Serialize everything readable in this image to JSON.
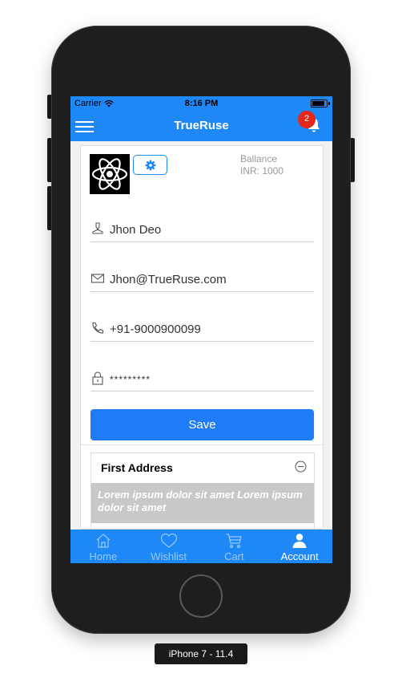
{
  "status_bar": {
    "carrier": "Carrier",
    "time": "8:16 PM"
  },
  "nav_bar": {
    "title": "TrueRuse",
    "notification_count": "2"
  },
  "profile": {
    "balance_label": "Ballance",
    "balance_value": "INR: 1000"
  },
  "fields": {
    "name": "Jhon Deo",
    "email": "Jhon@TrueRuse.com",
    "phone": "+91-9000900099",
    "password": "*********"
  },
  "save_label": "Save",
  "address": {
    "title": "First Address",
    "body": "Lorem ipsum dolor sit amet Lorem ipsum dolor sit amet"
  },
  "tabs": [
    {
      "label": "Home",
      "icon": "home-icon",
      "active": false
    },
    {
      "label": "Wishlist",
      "icon": "heart-icon",
      "active": false
    },
    {
      "label": "Cart",
      "icon": "cart-icon",
      "active": false
    },
    {
      "label": "Account",
      "icon": "user-icon",
      "active": true
    }
  ],
  "device_label": "iPhone 7 - 11.4",
  "colors": {
    "accent": "#1e88f7",
    "badge": "#e5281b",
    "address_body_bg": "#c8c8c8"
  }
}
